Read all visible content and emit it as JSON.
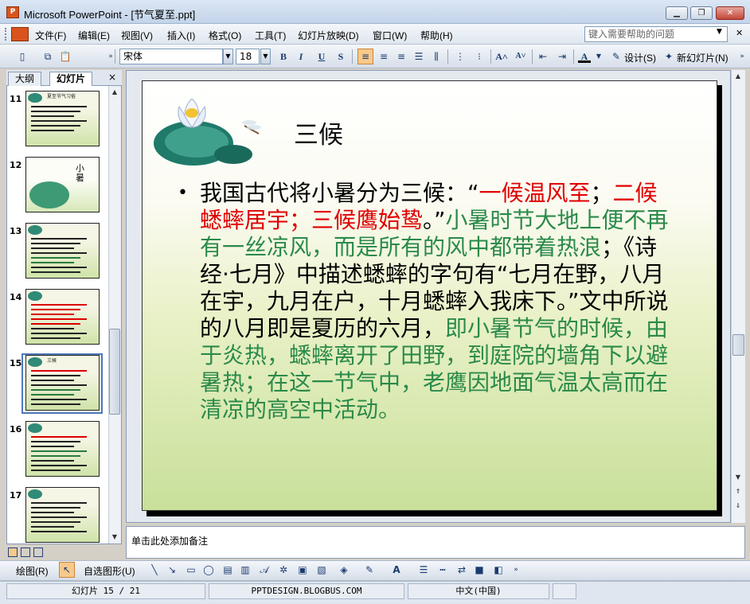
{
  "window": {
    "title": "Microsoft PowerPoint - [节气夏至.ppt]",
    "app_icon_label": "P",
    "colors": {
      "accent": "#d9541c",
      "selected_button": "#f7c98a"
    }
  },
  "menu": {
    "items": [
      "文件(F)",
      "编辑(E)",
      "视图(V)",
      "插入(I)",
      "格式(O)",
      "工具(T)",
      "幻灯片放映(D)",
      "窗口(W)",
      "帮助(H)"
    ],
    "help_placeholder": "键入需要帮助的问题"
  },
  "toolbar": {
    "font_name": "宋体",
    "font_size": "18",
    "bold": "B",
    "italic": "I",
    "underline": "U",
    "shadow": "S",
    "design_label": "设计(S)",
    "new_slide_label": "新幻灯片(N)"
  },
  "left_panel": {
    "tab_outline": "大纲",
    "tab_slides": "幻灯片",
    "close_glyph": "×",
    "selected_slide": 15,
    "thumbnails": [
      {
        "number": "11",
        "kind": "text",
        "title": "夏至节气习俗"
      },
      {
        "number": "12",
        "kind": "image",
        "title": "小暑"
      },
      {
        "number": "13",
        "kind": "text",
        "title": ""
      },
      {
        "number": "14",
        "kind": "text",
        "title": ""
      },
      {
        "number": "15",
        "kind": "text",
        "title": "三候"
      },
      {
        "number": "16",
        "kind": "text",
        "title": ""
      },
      {
        "number": "17",
        "kind": "text",
        "title": ""
      }
    ]
  },
  "slide": {
    "title": "三候",
    "bullet": "•",
    "runs": [
      {
        "color": "black",
        "text": "我国古代将小暑分为三候：“"
      },
      {
        "color": "red",
        "text": "一候温风至"
      },
      {
        "color": "black",
        "text": "；"
      },
      {
        "color": "red",
        "text": "二候蟋蟀居宇；三候鹰始鸷"
      },
      {
        "color": "black",
        "text": "。”"
      },
      {
        "color": "green",
        "text": "小暑时节大地上便不再有一丝凉风，而是所有的风中都带着热浪"
      },
      {
        "color": "black",
        "text": "；《诗经·七月》中描述蟋蟀的字句有“七月在野，八月在宇，九月在户，十月蟋蟀入我床下。”文中所说的八月即是夏历的六月，"
      },
      {
        "color": "green",
        "text": "即小暑节气的时候，由于炎热，蟋蟀离开了田野，到庭院的墙角下以避暑热；在这一节气中，老鹰因地面气温太高而在清凉的高空中活动。"
      }
    ]
  },
  "notes": {
    "placeholder": "单击此处添加备注"
  },
  "drawing_toolbar": {
    "draw_label": "绘图(R)",
    "autoshapes_label": "自选图形(U)"
  },
  "status": {
    "slide_indicator": "幻灯片 15 / 21",
    "design_name": "PPTDESIGN.BLOGBUS.COM",
    "language": "中文(中国)"
  }
}
